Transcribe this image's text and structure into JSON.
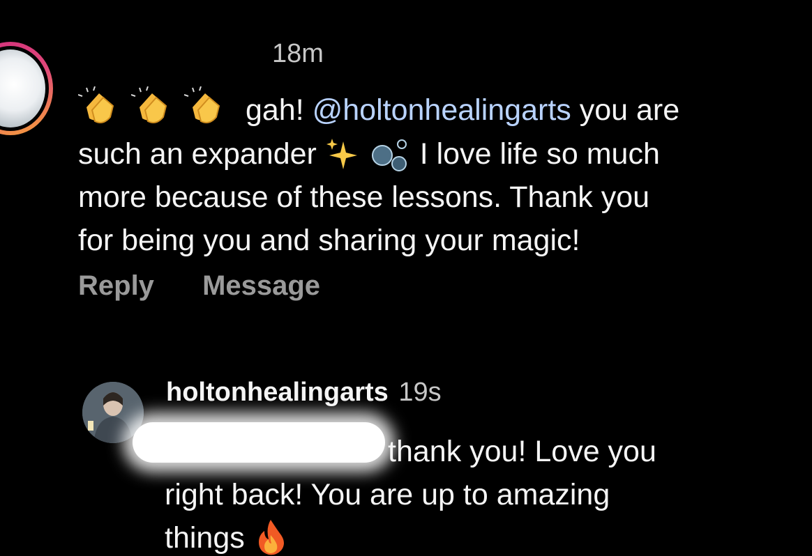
{
  "comment": {
    "time": "18m",
    "emoji_prefix": [
      "clapping-hands",
      "clapping-hands",
      "clapping-hands"
    ],
    "text_1": "gah!",
    "mention": "@holtonhealingarts",
    "text_2": "you are",
    "text_3": "such an expander",
    "emoji_mid": [
      "sparkles",
      "bubbles"
    ],
    "text_4": "I love life so much",
    "text_5": "more because of these lessons. Thank you",
    "text_6": "for being you and sharing your magic!"
  },
  "actions": {
    "reply_label": "Reply",
    "message_label": "Message"
  },
  "reply": {
    "username": "holtonhealingarts",
    "time": "19s",
    "line_1": "thank you! Love you",
    "line_2": "right back! You are up to amazing",
    "line_3": "things",
    "emoji_suffix": "fire"
  },
  "colors": {
    "background": "#000000",
    "text": "#f5f5f5",
    "muted": "#9a9a9a",
    "mention": "#b9d3ff",
    "story_ring_start": "#d1307c",
    "story_ring_end": "#f7a437"
  }
}
